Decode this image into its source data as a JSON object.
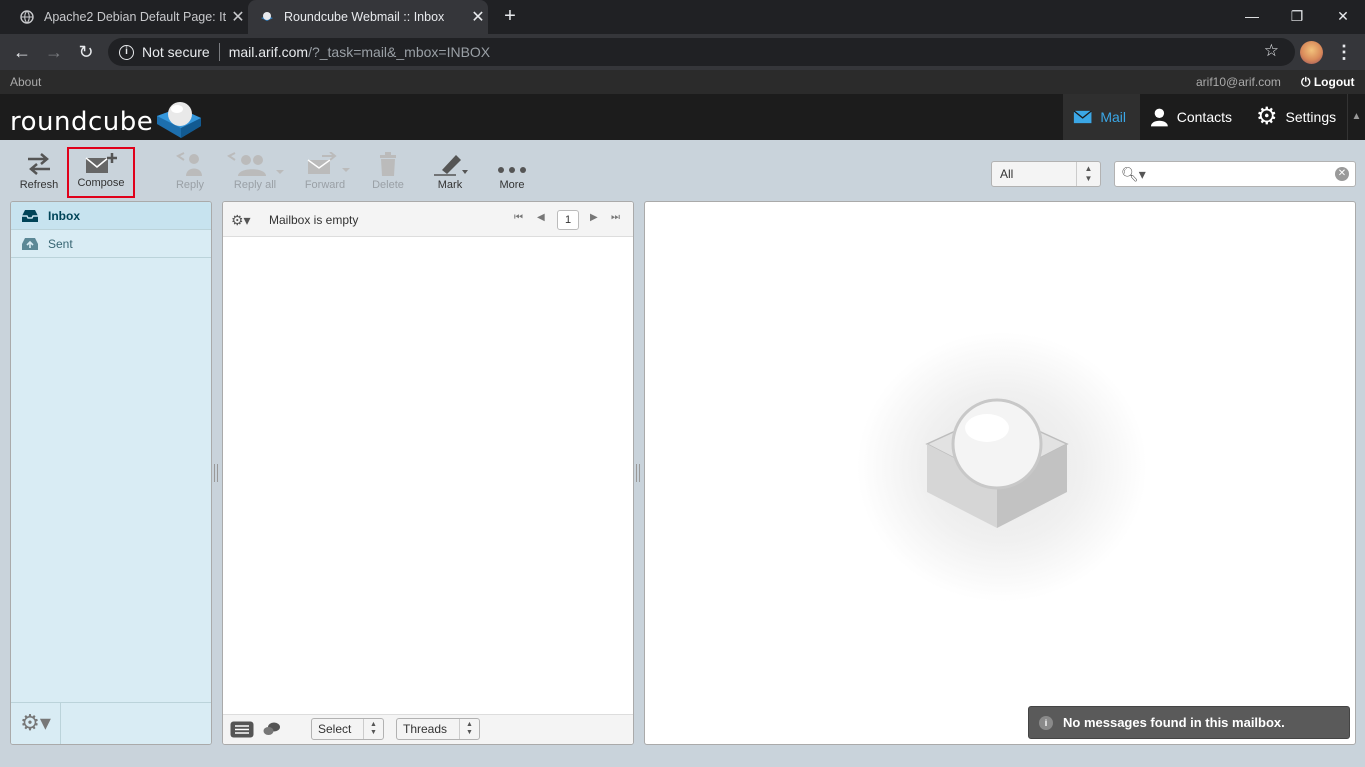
{
  "browser": {
    "tabs": [
      {
        "title": "Apache2 Debian Default Page: It",
        "close": "✕"
      },
      {
        "title": "Roundcube Webmail :: Inbox",
        "close": "✕"
      }
    ],
    "new_tab": "+",
    "window_controls": {
      "minimize": "—",
      "restore": "❐",
      "close": "✕"
    },
    "nav": {
      "back": "←",
      "forward": "→",
      "reload": "↻"
    },
    "security_label": "Not secure",
    "url_host": "mail.arif.com",
    "url_path": "/?_task=mail&_mbox=INBOX",
    "star": "☆",
    "menu": "⋮"
  },
  "topline": {
    "about": "About",
    "username": "arif10@arif.com",
    "logout": "Logout"
  },
  "header": {
    "logo_text": "roundcube",
    "tasks": [
      {
        "label": "Mail",
        "icon": "mail-icon"
      },
      {
        "label": "Contacts",
        "icon": "contacts-icon"
      },
      {
        "label": "Settings",
        "icon": "gear-icon"
      }
    ],
    "toggle": "▲"
  },
  "toolbar": {
    "refresh": "Refresh",
    "compose": "Compose",
    "reply": "Reply",
    "reply_all": "Reply all",
    "forward": "Forward",
    "delete": "Delete",
    "mark": "Mark",
    "more": "More"
  },
  "search": {
    "filter": "All",
    "icon": "🔍︎▾",
    "reset": "✕"
  },
  "folders": [
    {
      "name": "Inbox",
      "selected": true
    },
    {
      "name": "Sent",
      "selected": false
    }
  ],
  "folder_footer": {
    "gear": "⚙▾"
  },
  "messagelist": {
    "options": "⚙▾",
    "count": "Mailbox is empty",
    "page": "1",
    "first": "⏮",
    "prev": "◀",
    "next": "▶",
    "last": "⏭",
    "select": "Select",
    "threads": "Threads"
  },
  "notification": {
    "icon": "i",
    "text": "No messages found in this mailbox."
  },
  "colors": {
    "accent": "#3ba7e6",
    "highlight": "#e0001a",
    "folder_bg": "#d9ecf4"
  }
}
